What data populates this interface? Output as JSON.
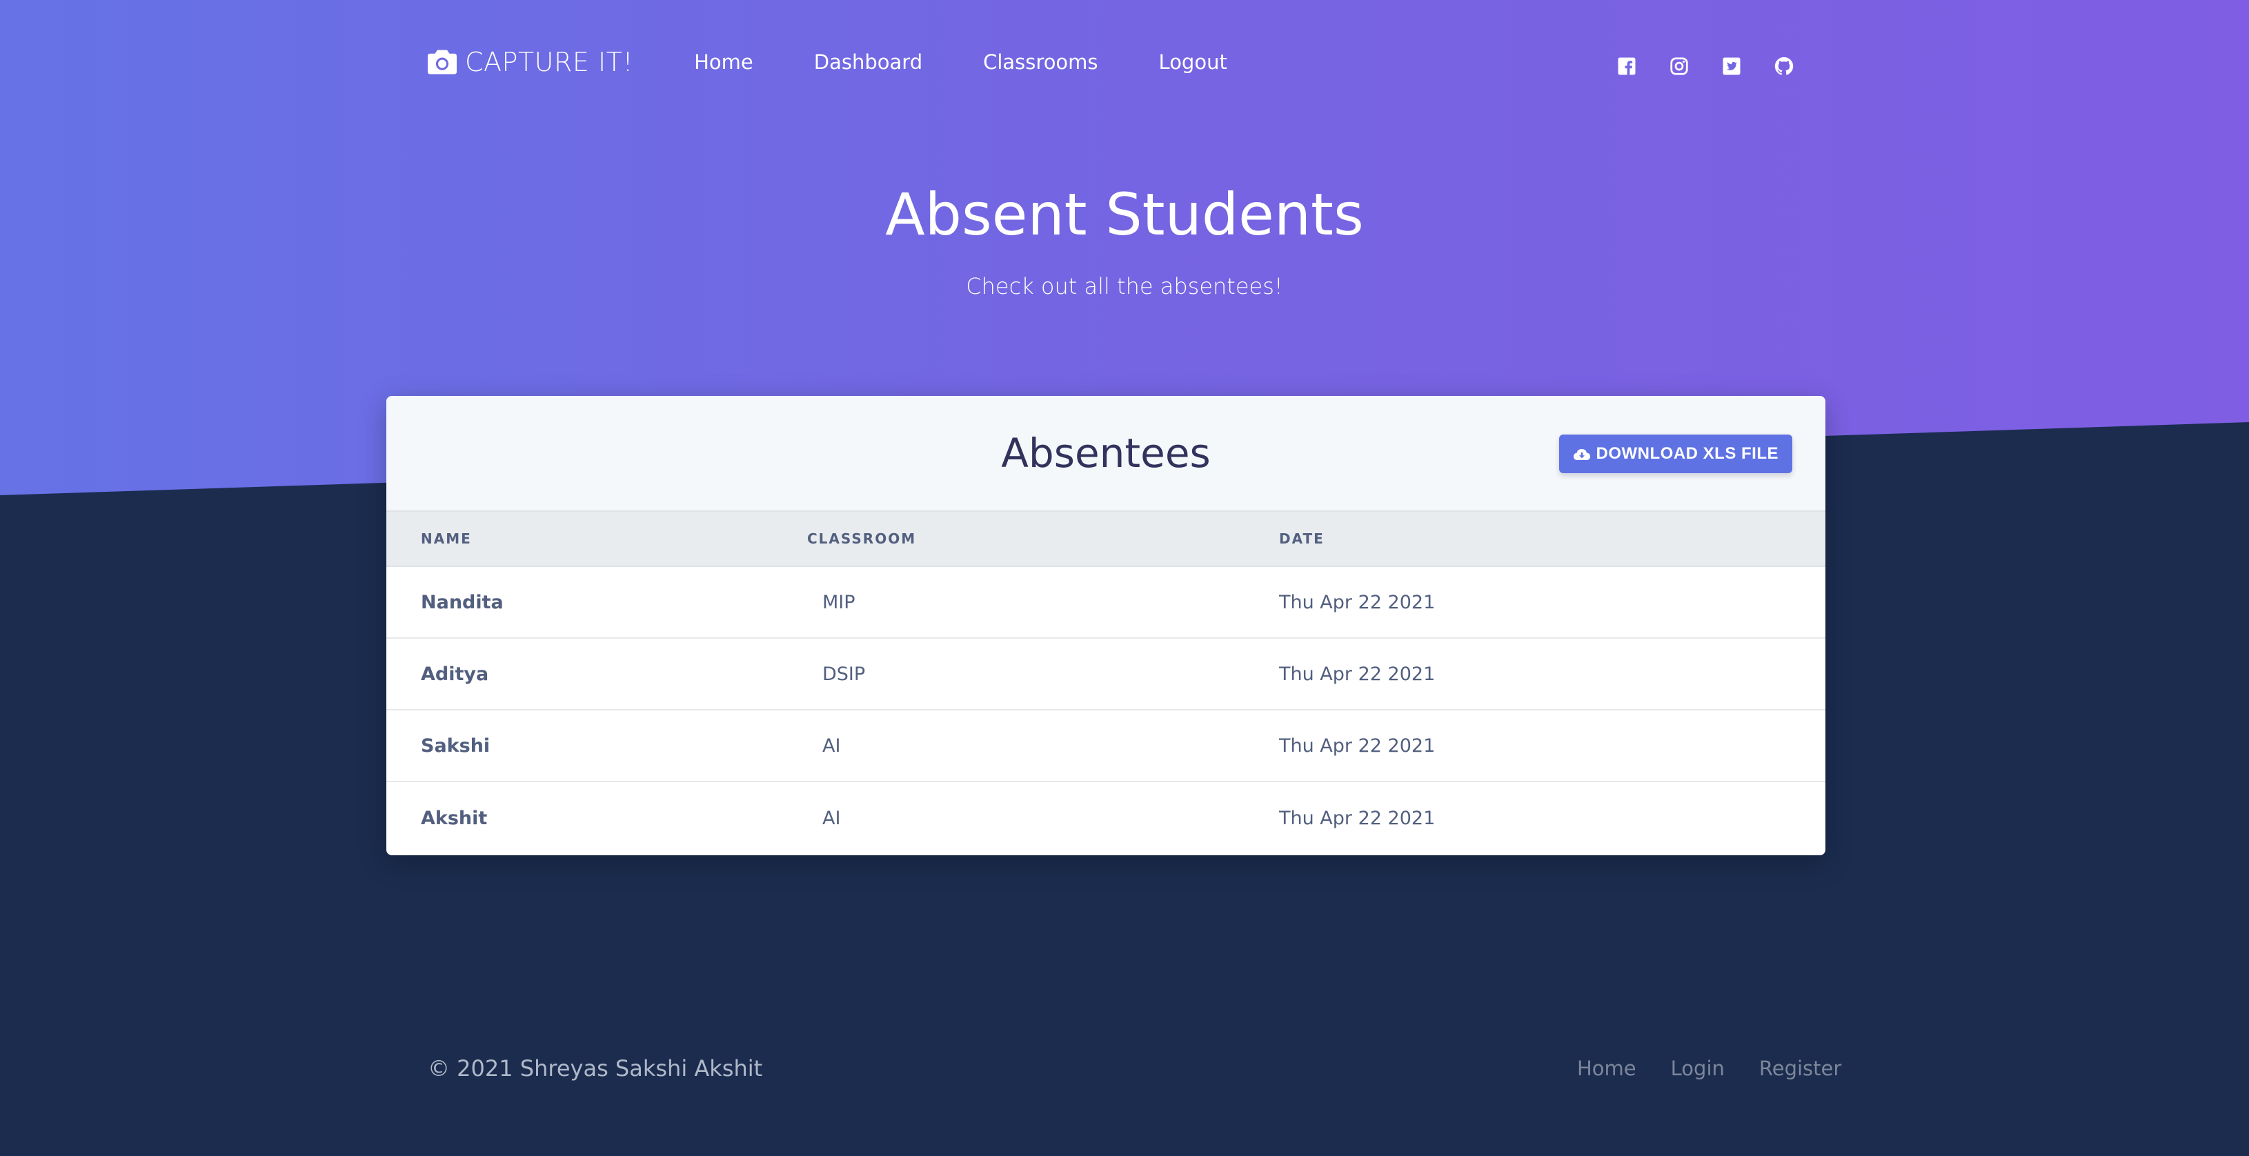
{
  "nav": {
    "brand": "CAPTURE IT!",
    "links": [
      {
        "label": "Home"
      },
      {
        "label": "Dashboard"
      },
      {
        "label": "Classrooms"
      },
      {
        "label": "Logout"
      }
    ],
    "social": [
      "facebook-icon",
      "instagram-icon",
      "twitter-icon",
      "github-icon"
    ]
  },
  "hero": {
    "title": "Absent Students",
    "subtitle": "Check out all the absentees!"
  },
  "card": {
    "title": "Absentees",
    "download_label": "DOWNLOAD XLS FILE",
    "columns": [
      "NAME",
      "CLASSROOM",
      "DATE"
    ],
    "rows": [
      {
        "name": "Nandita",
        "classroom": "MIP",
        "date": "Thu Apr 22 2021"
      },
      {
        "name": "Aditya",
        "classroom": "DSIP",
        "date": "Thu Apr 22 2021"
      },
      {
        "name": "Sakshi",
        "classroom": "AI",
        "date": "Thu Apr 22 2021"
      },
      {
        "name": "Akshit",
        "classroom": "AI",
        "date": "Thu Apr 22 2021"
      }
    ]
  },
  "footer": {
    "copyright": "© 2021 Shreyas Sakshi Akshit",
    "links": [
      {
        "label": "Home"
      },
      {
        "label": "Login"
      },
      {
        "label": "Register"
      }
    ]
  },
  "colors": {
    "primary": "#5e72e4",
    "dark_bg": "#1b2c4f",
    "gradient_start": "#6672e6",
    "gradient_end": "#7f5ee3"
  }
}
